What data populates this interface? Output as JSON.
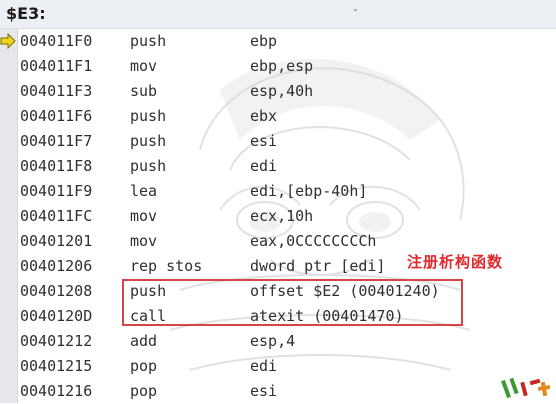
{
  "window": {
    "title": "$E3:",
    "title_mark": "-"
  },
  "current_row_index": 0,
  "rows": [
    {
      "addr": "004011F0",
      "mnemonic": "push",
      "operands": "ebp"
    },
    {
      "addr": "004011F1",
      "mnemonic": "mov",
      "operands": "ebp,esp"
    },
    {
      "addr": "004011F3",
      "mnemonic": "sub",
      "operands": "esp,40h"
    },
    {
      "addr": "004011F6",
      "mnemonic": "push",
      "operands": "ebx"
    },
    {
      "addr": "004011F7",
      "mnemonic": "push",
      "operands": "esi"
    },
    {
      "addr": "004011F8",
      "mnemonic": "push",
      "operands": "edi"
    },
    {
      "addr": "004011F9",
      "mnemonic": "lea",
      "operands": "edi,[ebp-40h]"
    },
    {
      "addr": "004011FC",
      "mnemonic": "mov",
      "operands": "ecx,10h"
    },
    {
      "addr": "00401201",
      "mnemonic": "mov",
      "operands": "eax,0CCCCCCCCh"
    },
    {
      "addr": "00401206",
      "mnemonic": "rep stos",
      "operands": "dword ptr [edi]"
    },
    {
      "addr": "00401208",
      "mnemonic": "push",
      "operands": "offset $E2 (00401240)"
    },
    {
      "addr": "0040120D",
      "mnemonic": "call",
      "operands": "atexit (00401470)"
    },
    {
      "addr": "00401212",
      "mnemonic": "add",
      "operands": "esp,4"
    },
    {
      "addr": "00401215",
      "mnemonic": "pop",
      "operands": "edi"
    },
    {
      "addr": "00401216",
      "mnemonic": "pop",
      "operands": "esi"
    }
  ],
  "annotation": "注册析构函数",
  "colors": {
    "annotation": "#e0292b",
    "highlight_box": "#d64545",
    "current_arrow": "#f2d21b"
  },
  "icons": {
    "current_line": "yellow-arrow-icon"
  }
}
